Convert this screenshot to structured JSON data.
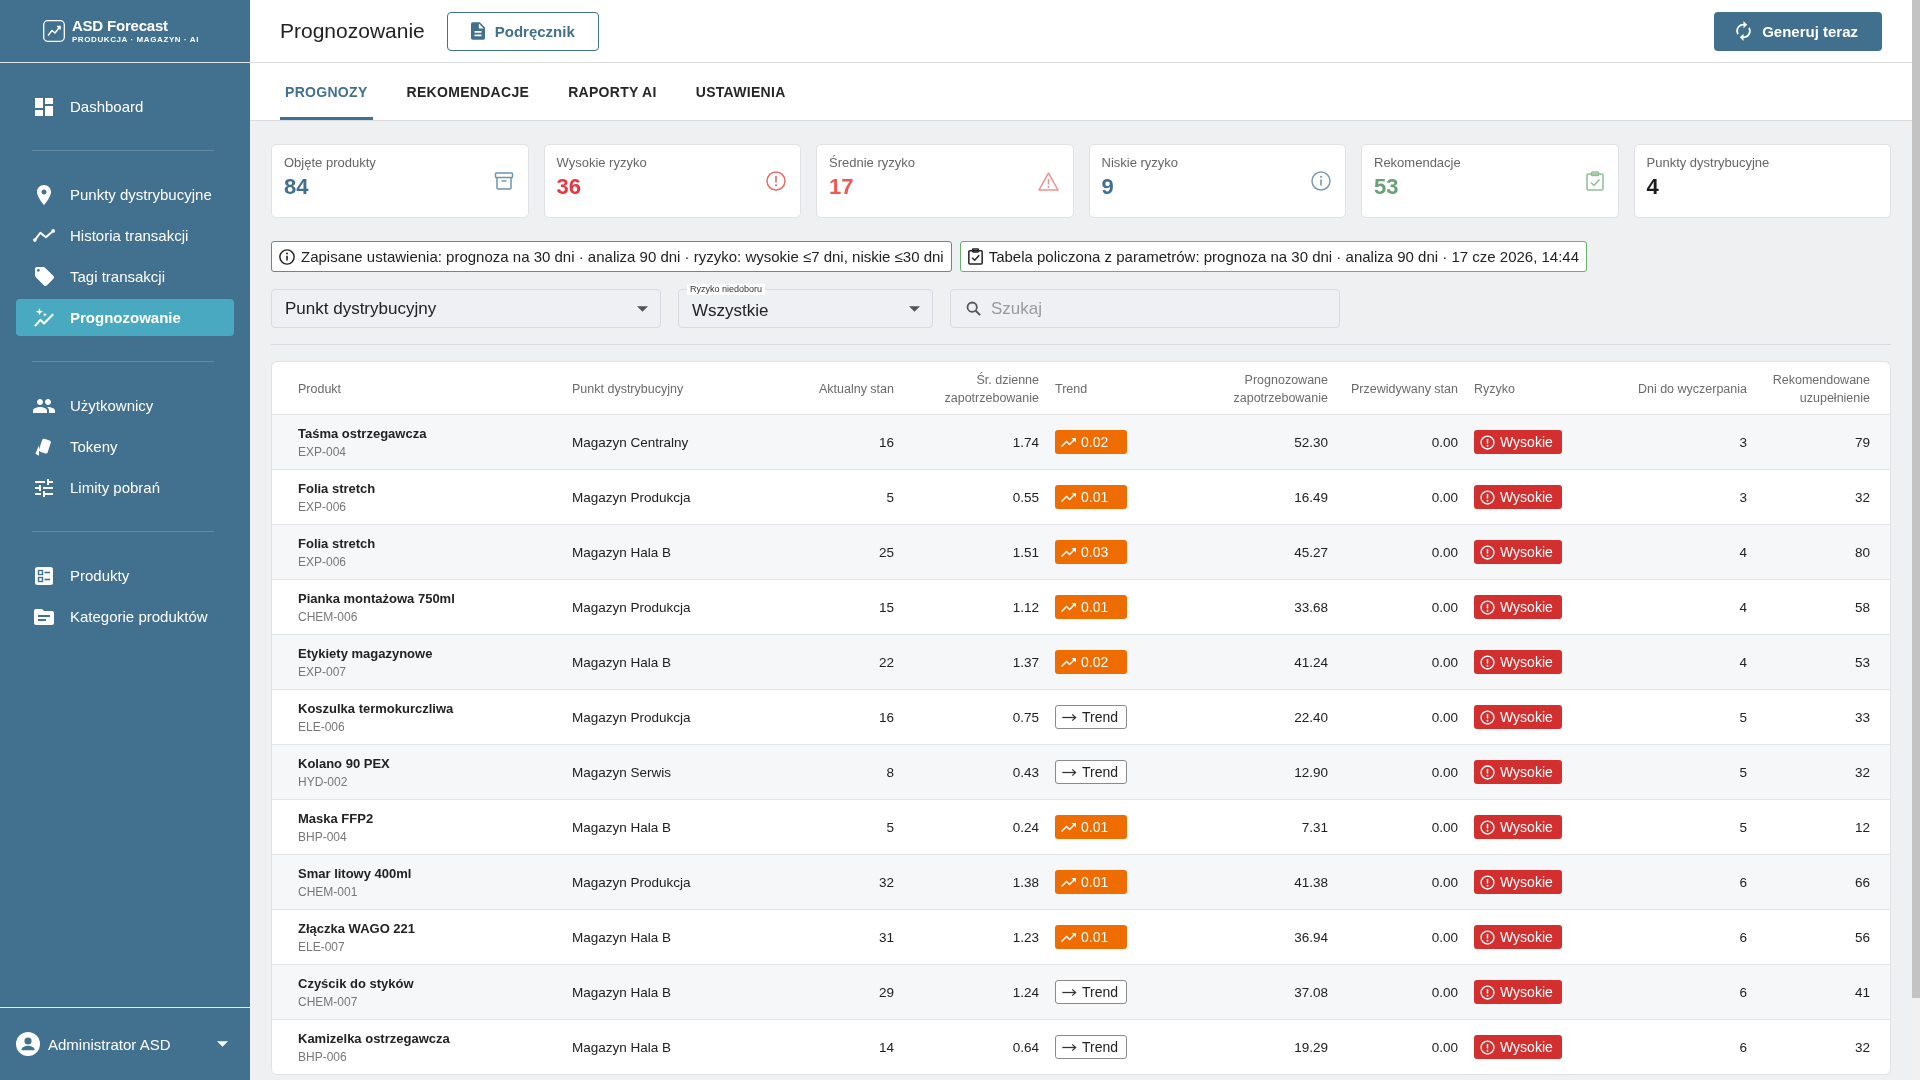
{
  "sidebar": {
    "logo": {
      "title": "ASD Forecast",
      "subtitle": "PRODUKCJA · MAGAZYN · AI"
    },
    "sections": [
      {
        "items": [
          {
            "label": "Dashboard",
            "selected": false
          }
        ]
      },
      {
        "items": [
          {
            "label": "Punkty dystrybucyjne",
            "selected": false
          },
          {
            "label": "Historia transakcji",
            "selected": false
          },
          {
            "label": "Tagi transakcji",
            "selected": false
          },
          {
            "label": "Prognozowanie",
            "selected": true
          }
        ]
      },
      {
        "items": [
          {
            "label": "Użytkownicy",
            "selected": false
          },
          {
            "label": "Tokeny",
            "selected": false
          },
          {
            "label": "Limity pobrań",
            "selected": false
          }
        ]
      },
      {
        "items": [
          {
            "label": "Produkty",
            "selected": false
          },
          {
            "label": "Kategorie produktów",
            "selected": false
          }
        ]
      }
    ],
    "user": {
      "name": "Administrator ASD"
    }
  },
  "header": {
    "title": "Prognozowanie",
    "manual_button": {
      "label": "Podręcznik"
    },
    "generate_button": {
      "label": "Generuj teraz"
    }
  },
  "tabs": [
    {
      "label": "PROGNOZY",
      "selected": true
    },
    {
      "label": "REKOMENDACJE",
      "selected": false
    },
    {
      "label": "RAPORTY AI",
      "selected": false
    },
    {
      "label": "USTAWIENIA",
      "selected": false
    }
  ],
  "stats": [
    {
      "kind": "products",
      "label": "Objęte produkty",
      "value": "84"
    },
    {
      "kind": "high_risk",
      "label": "Wysokie ryzyko",
      "value": "36"
    },
    {
      "kind": "medium_risk",
      "label": "Średnie ryzyko",
      "value": "17"
    },
    {
      "kind": "low_risk",
      "label": "Niskie ryzyko",
      "value": "9"
    },
    {
      "kind": "recommendations",
      "label": "Rekomendacje",
      "value": "53"
    },
    {
      "kind": "points",
      "label": "Punkty dystrybucyjne",
      "value": "4"
    }
  ],
  "banners": [
    {
      "kind": "info",
      "text": "Zapisane ustawienia: prognoza na 30 dni · analiza 90 dni · ryzyko: wysokie ≤7 dni, niskie ≤30 dni"
    },
    {
      "kind": "success",
      "text": "Tabela policzona z parametrów: prognoza na 30 dni · analiza 90 dni · 17 cze 2026, 14:44"
    }
  ],
  "filters": {
    "distribution_point": {
      "label": "Punkt dystrybucyjny"
    },
    "shortage_risk": {
      "label": "Ryzyko niedoboru",
      "value": "Wszystkie"
    },
    "search": {
      "placeholder": "Szukaj"
    }
  },
  "table": {
    "columns": [
      "Produkt",
      "Punkt dystrybucyjny",
      "Aktualny stan",
      "Śr. dzienne zapotrzebowanie",
      "Trend",
      "Prognozowane zapotrzebowanie",
      "Przewidywany stan",
      "Ryzyko",
      "Dni do wyczerpania",
      "Rekomendowane uzupełnienie"
    ],
    "rows": [
      {
        "product": "Taśma ostrzegawcza",
        "code": "EXP-004",
        "point": "Magazyn Centralny",
        "stock": "16",
        "avg_daily_demand": "1.74",
        "trend": {
          "kind": "up",
          "label": "0.02"
        },
        "forecast_demand": "52.30",
        "projected_stock": "0.00",
        "risk": {
          "kind": "high",
          "label": "Wysokie"
        },
        "days_to_depletion": "3",
        "recommended_refill": "79"
      },
      {
        "product": "Folia stretch",
        "code": "EXP-006",
        "point": "Magazyn Produkcja",
        "stock": "5",
        "avg_daily_demand": "0.55",
        "trend": {
          "kind": "up",
          "label": "0.01"
        },
        "forecast_demand": "16.49",
        "projected_stock": "0.00",
        "risk": {
          "kind": "high",
          "label": "Wysokie"
        },
        "days_to_depletion": "3",
        "recommended_refill": "32"
      },
      {
        "product": "Folia stretch",
        "code": "EXP-006",
        "point": "Magazyn Hala B",
        "stock": "25",
        "avg_daily_demand": "1.51",
        "trend": {
          "kind": "up",
          "label": "0.03"
        },
        "forecast_demand": "45.27",
        "projected_stock": "0.00",
        "risk": {
          "kind": "high",
          "label": "Wysokie"
        },
        "days_to_depletion": "4",
        "recommended_refill": "80"
      },
      {
        "product": "Pianka montażowa 750ml",
        "code": "CHEM-006",
        "point": "Magazyn Produkcja",
        "stock": "15",
        "avg_daily_demand": "1.12",
        "trend": {
          "kind": "up",
          "label": "0.01"
        },
        "forecast_demand": "33.68",
        "projected_stock": "0.00",
        "risk": {
          "kind": "high",
          "label": "Wysokie"
        },
        "days_to_depletion": "4",
        "recommended_refill": "58"
      },
      {
        "product": "Etykiety magazynowe",
        "code": "EXP-007",
        "point": "Magazyn Hala B",
        "stock": "22",
        "avg_daily_demand": "1.37",
        "trend": {
          "kind": "up",
          "label": "0.02"
        },
        "forecast_demand": "41.24",
        "projected_stock": "0.00",
        "risk": {
          "kind": "high",
          "label": "Wysokie"
        },
        "days_to_depletion": "4",
        "recommended_refill": "53"
      },
      {
        "product": "Koszulka termokurczliwa",
        "code": "ELE-006",
        "point": "Magazyn Produkcja",
        "stock": "16",
        "avg_daily_demand": "0.75",
        "trend": {
          "kind": "flat",
          "label": "Trend"
        },
        "forecast_demand": "22.40",
        "projected_stock": "0.00",
        "risk": {
          "kind": "high",
          "label": "Wysokie"
        },
        "days_to_depletion": "5",
        "recommended_refill": "33"
      },
      {
        "product": "Kolano 90 PEX",
        "code": "HYD-002",
        "point": "Magazyn Serwis",
        "stock": "8",
        "avg_daily_demand": "0.43",
        "trend": {
          "kind": "flat",
          "label": "Trend"
        },
        "forecast_demand": "12.90",
        "projected_stock": "0.00",
        "risk": {
          "kind": "high",
          "label": "Wysokie"
        },
        "days_to_depletion": "5",
        "recommended_refill": "32"
      },
      {
        "product": "Maska FFP2",
        "code": "BHP-004",
        "point": "Magazyn Hala B",
        "stock": "5",
        "avg_daily_demand": "0.24",
        "trend": {
          "kind": "up",
          "label": "0.01"
        },
        "forecast_demand": "7.31",
        "projected_stock": "0.00",
        "risk": {
          "kind": "high",
          "label": "Wysokie"
        },
        "days_to_depletion": "5",
        "recommended_refill": "12"
      },
      {
        "product": "Smar litowy 400ml",
        "code": "CHEM-001",
        "point": "Magazyn Produkcja",
        "stock": "32",
        "avg_daily_demand": "1.38",
        "trend": {
          "kind": "up",
          "label": "0.01"
        },
        "forecast_demand": "41.38",
        "projected_stock": "0.00",
        "risk": {
          "kind": "high",
          "label": "Wysokie"
        },
        "days_to_depletion": "6",
        "recommended_refill": "66"
      },
      {
        "product": "Złączka WAGO 221",
        "code": "ELE-007",
        "point": "Magazyn Hala B",
        "stock": "31",
        "avg_daily_demand": "1.23",
        "trend": {
          "kind": "up",
          "label": "0.01"
        },
        "forecast_demand": "36.94",
        "projected_stock": "0.00",
        "risk": {
          "kind": "high",
          "label": "Wysokie"
        },
        "days_to_depletion": "6",
        "recommended_refill": "56"
      },
      {
        "product": "Czyścik do styków",
        "code": "CHEM-007",
        "point": "Magazyn Hala B",
        "stock": "29",
        "avg_daily_demand": "1.24",
        "trend": {
          "kind": "flat",
          "label": "Trend"
        },
        "forecast_demand": "37.08",
        "projected_stock": "0.00",
        "risk": {
          "kind": "high",
          "label": "Wysokie"
        },
        "days_to_depletion": "6",
        "recommended_refill": "41"
      },
      {
        "product": "Kamizelka ostrzegawcza",
        "code": "BHP-006",
        "point": "Magazyn Hala B",
        "stock": "14",
        "avg_daily_demand": "0.64",
        "trend": {
          "kind": "flat",
          "label": "Trend"
        },
        "forecast_demand": "19.29",
        "projected_stock": "0.00",
        "risk": {
          "kind": "high",
          "label": "Wysokie"
        },
        "days_to_depletion": "6",
        "recommended_refill": "32"
      }
    ]
  }
}
